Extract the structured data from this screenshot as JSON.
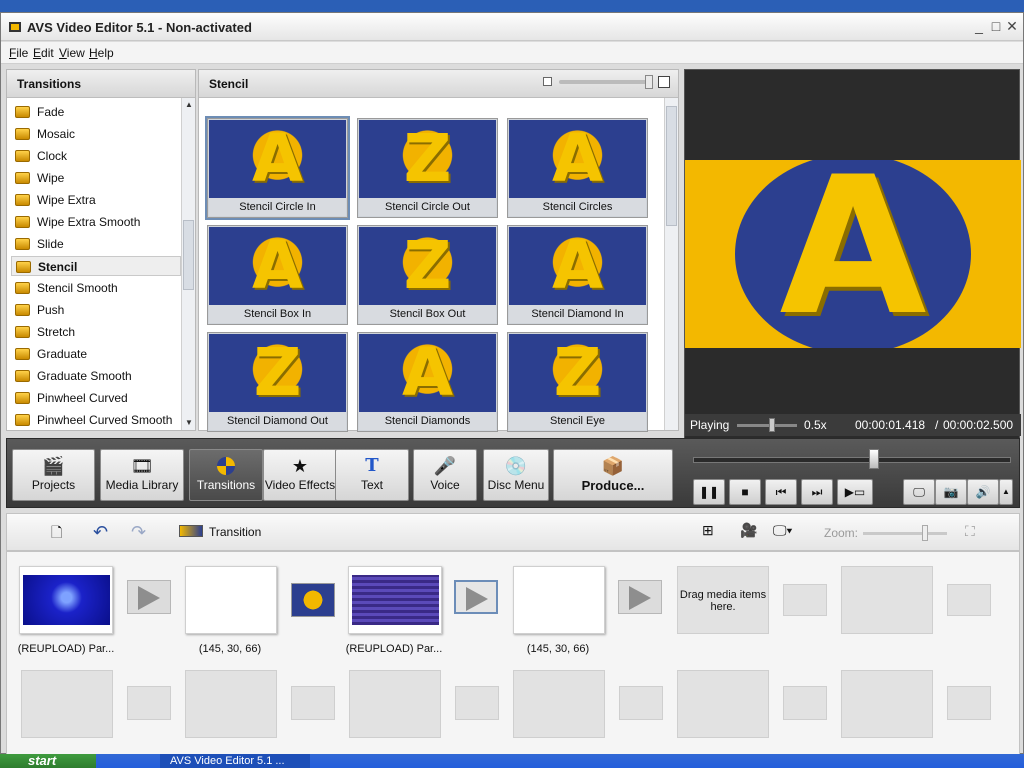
{
  "window": {
    "title": "AVS Video Editor 5.1 - Non-activated",
    "buttons": [
      "_",
      "□",
      "✕"
    ]
  },
  "menu": [
    {
      "u": "F",
      "rest": "ile"
    },
    {
      "u": "E",
      "rest": "dit"
    },
    {
      "u": "V",
      "rest": "iew"
    },
    {
      "u": "H",
      "rest": "elp"
    }
  ],
  "left_panel": {
    "title": "Transitions",
    "items": [
      "Fade",
      "Mosaic",
      "Clock",
      "Wipe",
      "Wipe Extra",
      "Wipe Extra Smooth",
      "Slide",
      "Stencil",
      "Stencil Smooth",
      "Push",
      "Stretch",
      "Graduate",
      "Graduate Smooth",
      "Pinwheel Curved",
      "Pinwheel Curved Smooth"
    ],
    "selected_index": 7
  },
  "grid_panel": {
    "title": "Stencil",
    "effects": [
      {
        "label": "Stencil Circle In",
        "glyph": "A"
      },
      {
        "label": "Stencil Circle Out",
        "glyph": "Z"
      },
      {
        "label": "Stencil Circles",
        "glyph": "A"
      },
      {
        "label": "Stencil Box In",
        "glyph": "A"
      },
      {
        "label": "Stencil Box Out",
        "glyph": "Z"
      },
      {
        "label": "Stencil Diamond In",
        "glyph": "A"
      },
      {
        "label": "Stencil Diamond Out",
        "glyph": "Z"
      },
      {
        "label": "Stencil Diamonds",
        "glyph": "A"
      },
      {
        "label": "Stencil Eye",
        "glyph": "Z"
      }
    ]
  },
  "preview": {
    "glyph": "A",
    "status": "Playing",
    "speed": "0.5x",
    "time_current": "00:00:01.418",
    "time_separator": "/",
    "time_total": "00:00:02.500"
  },
  "toolbar": {
    "buttons": [
      {
        "label": "Projects",
        "icon": "clapper-icon"
      },
      {
        "label": "Media Library",
        "icon": "film-icon"
      },
      {
        "label": "Transitions",
        "icon": "transition-icon"
      },
      {
        "label": "Video Effects",
        "icon": "star-icon"
      },
      {
        "label": "Text",
        "icon": "text-icon"
      },
      {
        "label": "Voice",
        "icon": "microphone-icon"
      },
      {
        "label": "Disc Menu",
        "icon": "disc-icon"
      },
      {
        "label": "Produce...",
        "icon": "produce-icon"
      }
    ]
  },
  "timeline_bar": {
    "mode_label": "Transition",
    "zoom_label": "Zoom:"
  },
  "storyboard": {
    "clip1_label": "(REUPLOAD) Par...",
    "color1_label": "(145, 30, 66)",
    "clip2_label": "(REUPLOAD) Par...",
    "color2_label": "(145, 30, 66)",
    "drop_hint": "Drag media items here."
  },
  "taskbar": {
    "start_label": "start",
    "task_label": "AVS Video Editor 5.1 ..."
  },
  "colors": {
    "accent_yellow": "#f3b800",
    "accent_blue": "#2c3f8f",
    "toolbar_dark": "#4a4a4a"
  }
}
